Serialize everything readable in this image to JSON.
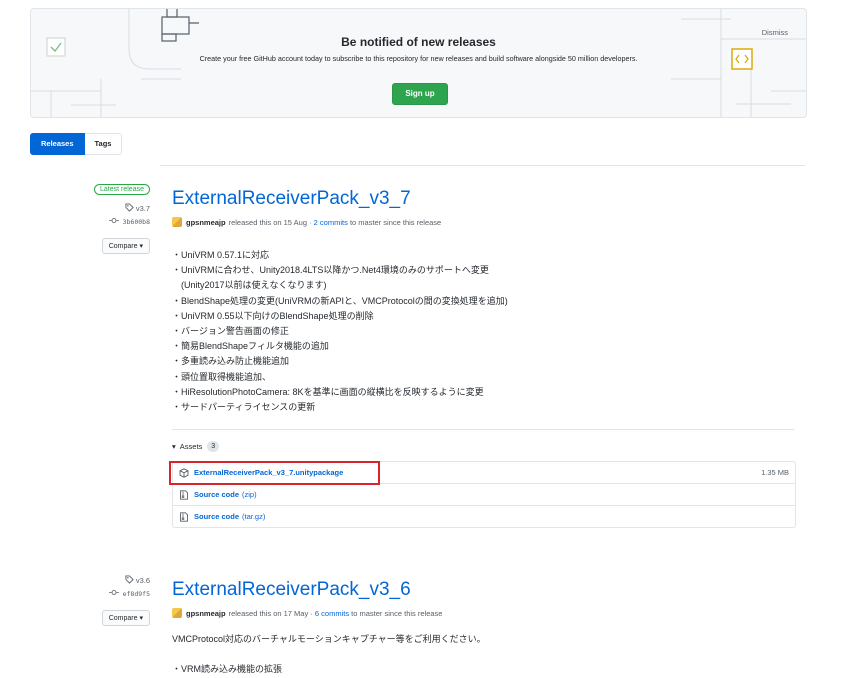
{
  "banner": {
    "title": "Be notified of new releases",
    "text": "Create your free GitHub account today to subscribe to this repository for new releases and build software alongside 50 million developers.",
    "signup_label": "Sign up",
    "dismiss_label": "Dismiss"
  },
  "tabs": {
    "releases": "Releases",
    "tags": "Tags"
  },
  "release1": {
    "badge": "Latest release",
    "tag": "v3.7",
    "commit": "3b600b8",
    "compare": "Compare",
    "title": "ExternalReceiverPack_v3_7",
    "author": "gpsnmeajp",
    "byline_pre": "released this on 15 Aug ·",
    "commits_link": "2 commits",
    "byline_post": "to master since this release",
    "notes": [
      "・UniVRM 0.57.1に対応",
      "・UniVRMに合わせ、Unity2018.4LTS以降かつ.Net4環境のみのサポートへ変更",
      "　(Unity2017以前は使えなくなります)",
      "・BlendShape処理の変更(UniVRMの新APIと、VMCProtocolの間の変換処理を追加)",
      "・UniVRM 0.55以下向けのBlendShape処理の削除",
      "・バージョン警告画面の修正",
      "・簡易BlendShapeフィルタ機能の追加",
      "・多重読み込み防止機能追加",
      "・頭位置取得機能追加、",
      "・HiResolutionPhotoCamera: 8Kを基準に画面の縦横比を反映するように変更",
      "・サードパーティライセンスの更新"
    ],
    "assets_label": "Assets",
    "assets_count": "3",
    "assets": [
      {
        "name": "ExternalReceiverPack_v3_7.unitypackage",
        "ext": "",
        "size": "1.35 MB"
      },
      {
        "name": "Source code",
        "ext": "(zip)",
        "size": ""
      },
      {
        "name": "Source code",
        "ext": "(tar.gz)",
        "size": ""
      }
    ]
  },
  "release2": {
    "tag": "v3.6",
    "commit": "ef8d9f5",
    "compare": "Compare",
    "title": "ExternalReceiverPack_v3_6",
    "author": "gpsnmeajp",
    "byline_pre": "released this on 17 May ·",
    "commits_link": "6 commits",
    "byline_post": "to master since this release",
    "notes": [
      "VMCProtocol対応のバーチャルモーションキャプチャー等をご利用ください。",
      "",
      "・VRM読み込み機能の拡張"
    ]
  },
  "colors": {
    "accent": "#0366d6",
    "signup": "#2ea44f",
    "latest": "#28a745",
    "highlight": "#d7262b"
  }
}
